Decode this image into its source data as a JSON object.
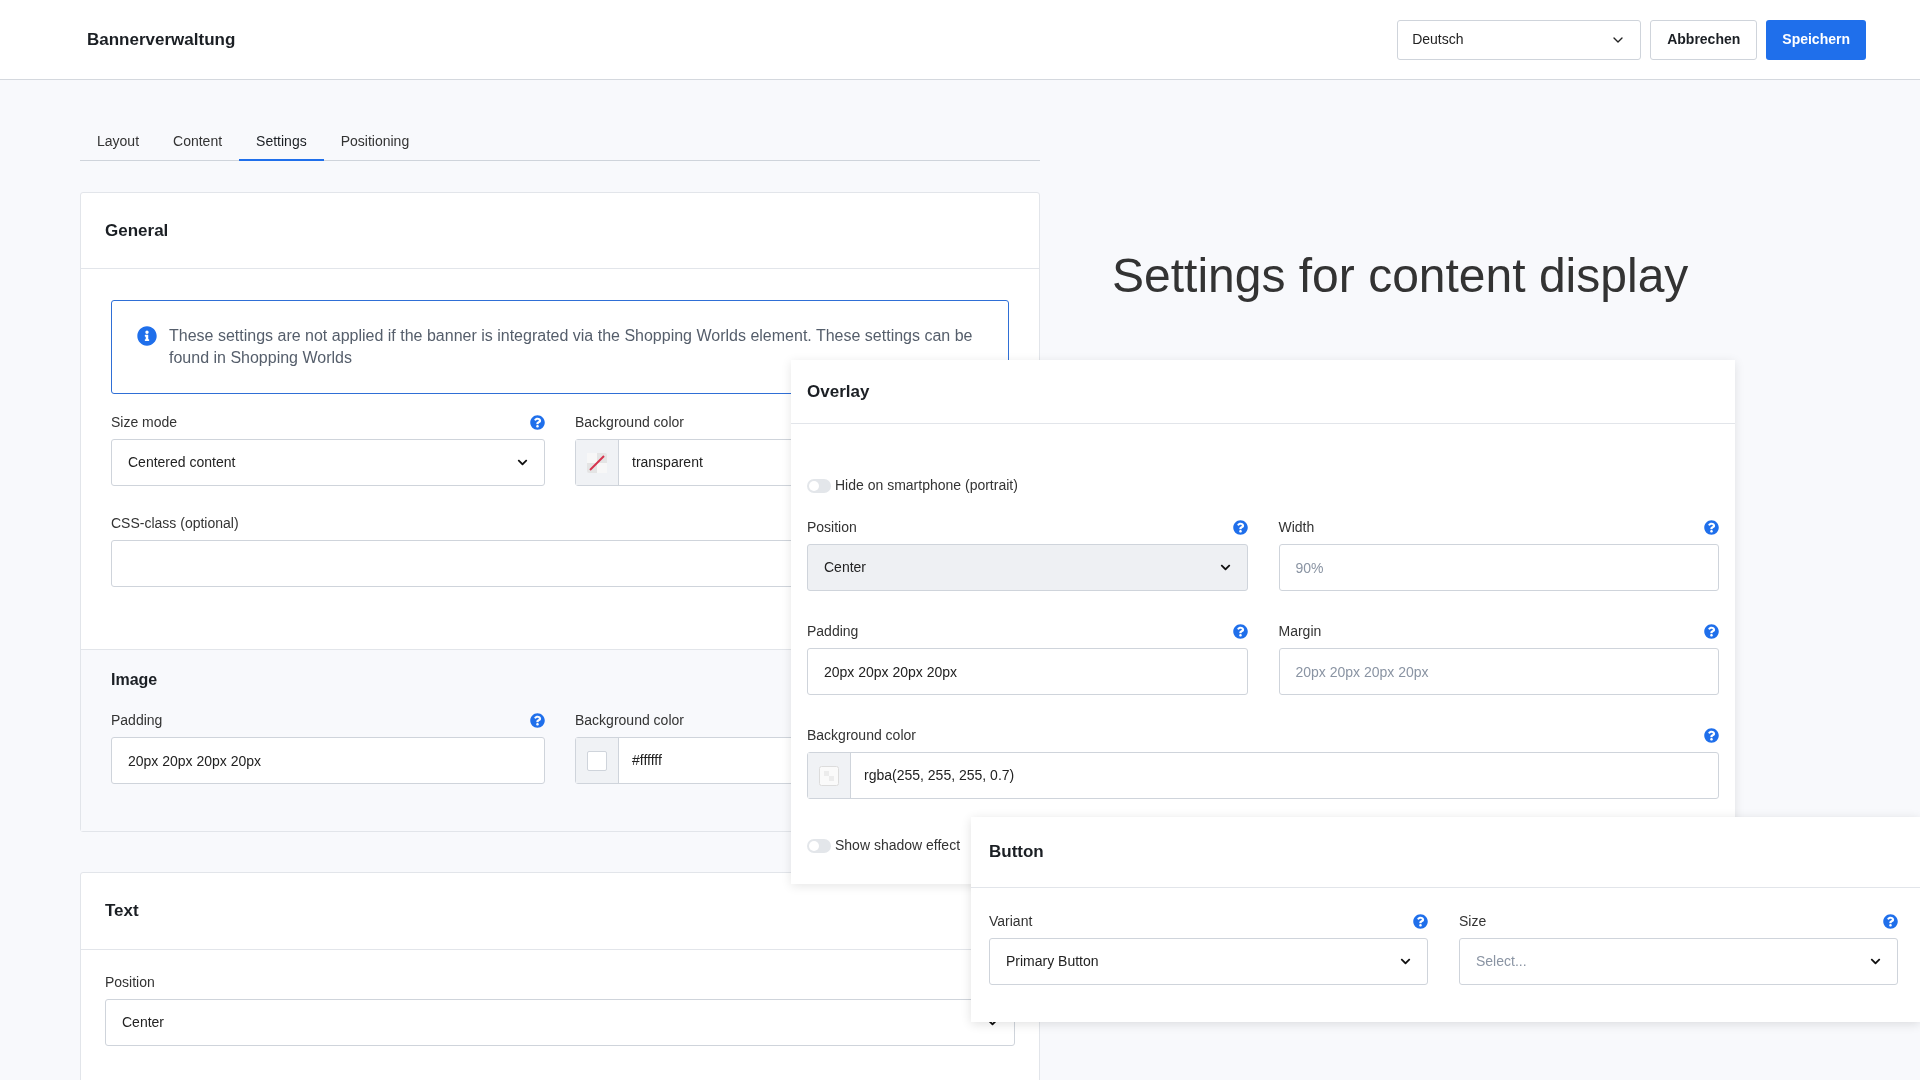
{
  "header": {
    "title": "Bannerverwaltung",
    "language": "Deutsch",
    "buttons": [
      {
        "label": "Abbrechen",
        "kind": "secondary"
      },
      {
        "label": "Speichern",
        "kind": "primary"
      }
    ]
  },
  "tabs": [
    {
      "label": "Layout",
      "selected": false
    },
    {
      "label": "Content",
      "selected": false
    },
    {
      "label": "Settings",
      "selected": true
    },
    {
      "label": "Positioning",
      "selected": false
    }
  ],
  "general": {
    "title": "General",
    "info": "These settings are not applied if the banner is integrated via the Shopping Worlds element. These settings can be found in Shopping Worlds",
    "size_mode": {
      "label": "Size mode",
      "value": "Centered content",
      "disabled": false
    },
    "background_color": {
      "label": "Background color",
      "value": "transparent",
      "kind": "none"
    },
    "css_class": {
      "label": "CSS-class (optional)"
    }
  },
  "image": {
    "title": "Image",
    "padding": {
      "label": "Padding",
      "value": "20px 20px 20px 20px"
    },
    "background_color": {
      "label": "Background color",
      "value": "#ffffff",
      "kind": "solid"
    }
  },
  "text": {
    "title": "Text",
    "position": {
      "label": "Position",
      "value": "Center",
      "disabled": false
    }
  },
  "heading": "Settings for content display",
  "overlay": {
    "title": "Overlay",
    "hide_on_smartphone": {
      "label": "Hide on smartphone (portrait)",
      "on": false
    },
    "position": {
      "label": "Position",
      "value": "Center",
      "disabled": true
    },
    "width": {
      "label": "Width",
      "placeholder": "90%"
    },
    "padding": {
      "label": "Padding",
      "value": "20px 20px 20px 20px"
    },
    "margin": {
      "label": "Margin",
      "placeholder": "20px 20px 20px 20px"
    },
    "background_color": {
      "label": "Background color",
      "value": "rgba(255, 255, 255, 0.7)",
      "kind": "alpha"
    },
    "shadow": {
      "label": "Show shadow effect",
      "on": false
    }
  },
  "button": {
    "title": "Button",
    "variant": {
      "label": "Variant",
      "value": "Primary Button",
      "disabled": false
    },
    "size": {
      "label": "Size",
      "placeholder": "Select..."
    }
  }
}
